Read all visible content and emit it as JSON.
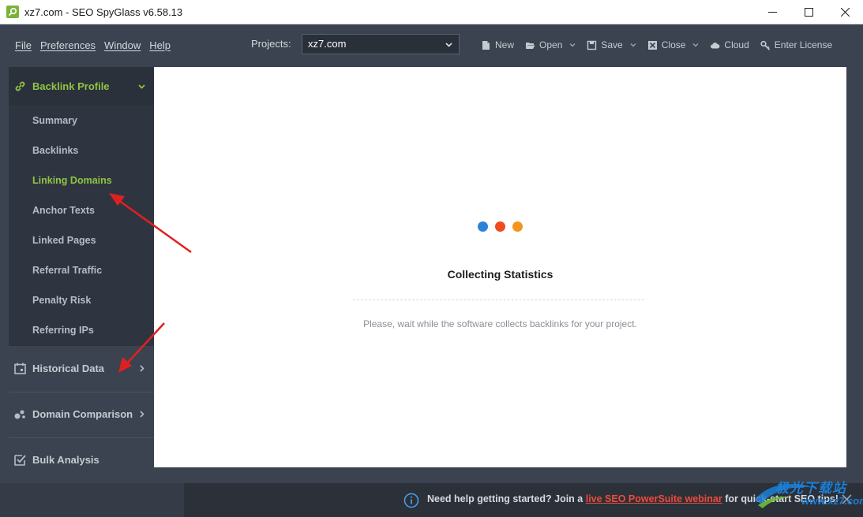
{
  "window": {
    "title": "xz7.com - SEO SpyGlass v6.58.13"
  },
  "menu": [
    "File",
    "Preferences",
    "Window",
    "Help"
  ],
  "projects": {
    "label": "Projects:",
    "selected": "xz7.com"
  },
  "toolbar": {
    "new": "New",
    "open": "Open",
    "save": "Save",
    "close": "Close",
    "cloud": "Cloud",
    "license": "Enter License"
  },
  "sidebar": {
    "backlink_profile": "Backlink Profile",
    "items": [
      "Summary",
      "Backlinks",
      "Linking Domains",
      "Anchor Texts",
      "Linked Pages",
      "Referral Traffic",
      "Penalty Risk",
      "Referring IPs"
    ],
    "active_item": "Linking Domains",
    "historical_data": "Historical Data",
    "domain_comparison": "Domain Comparison",
    "bulk_analysis": "Bulk Analysis"
  },
  "main": {
    "loading_title": "Collecting Statistics",
    "loading_sub": "Please, wait while the software collects backlinks for your project."
  },
  "bottom": {
    "text_before": "Need help getting started? Join a ",
    "link": "live SEO PowerSuite webinar",
    "text_after": " for quick-start SEO tips!"
  },
  "watermark": {
    "line1": "极光下载站",
    "line2": "www.xz7.com"
  },
  "colors": {
    "accent_green": "#8fc442",
    "dot_blue": "#2a83d8",
    "dot_red": "#f04a1e",
    "dot_orange": "#f5941d",
    "link_red": "#ef4b3c",
    "annotation_red": "#e02020"
  }
}
